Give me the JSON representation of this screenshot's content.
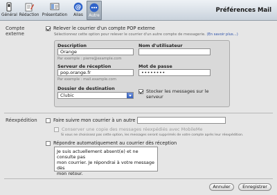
{
  "toolbar": {
    "items": [
      {
        "label": "Général",
        "icon": "switch-icon"
      },
      {
        "label": "Rédaction",
        "icon": "compose-icon"
      },
      {
        "label": "Présentation",
        "icon": "presentation-icon"
      },
      {
        "label": "Alias",
        "icon": "at-icon"
      },
      {
        "label": "Autre",
        "icon": "more-icon"
      }
    ],
    "selected": "Autre"
  },
  "title": "Préférences Mail",
  "account": {
    "section_label_1": "Compte",
    "section_label_2": "externe",
    "checkbox_label": "Relever le courrier d'un compte POP externe",
    "subnote": "Sélectionnez cette option pour relever le courrier d'un autre compte de messagerie.",
    "learn_more": "(En savoir plus...)",
    "description_label": "Description",
    "description_value": "Orange",
    "description_hint": "Par exemple : pierre@example.com",
    "username_label": "Nom d'utilisateur",
    "username_value": "",
    "server_label": "Serveur de réception",
    "server_value": "pop.orange.fr",
    "server_hint": "Par exemple : mail.example.com",
    "password_label": "Mot de passe",
    "password_value": "••••••••",
    "folder_label": "Dossier de destination",
    "folder_value": "Clubic",
    "store_label_1": "Stocker les messages sur le",
    "store_label_2": "serveur"
  },
  "forwarding": {
    "section_label": "Réexpédition",
    "forward_label": "Faire suivre mon courrier à un autre compte :",
    "forward_value": "",
    "keep_copy_label": "Conserver une copie des messages réexpédiés avec MobileMe",
    "keep_copy_note": "Si vous ne choisissez pas cette option, les messages seront supprimés de votre compte après leur réexpédition.",
    "auto_reply_label": "Répondre automatiquement au courrier dès réception",
    "auto_reply_lines": [
      "Je suis actuellement absent(e) et ne consulte pas",
      "mon courrier. Je répondrai à votre message dès",
      "mon retour."
    ]
  },
  "buttons": {
    "cancel": "Annuler",
    "save": "Enregistrer"
  }
}
